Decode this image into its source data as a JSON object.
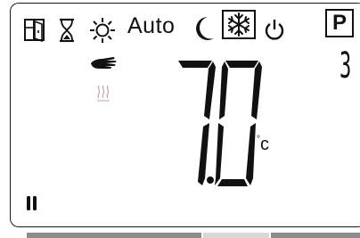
{
  "display": {
    "mode_label": "Auto",
    "program_label": "P",
    "program_number": "3",
    "temperature": "7.0",
    "temperature_unit": "°C",
    "unit_symbol": "c"
  },
  "icons": [
    "window-open-icon",
    "hourglass-icon",
    "sun-icon",
    "moon-icon",
    "snowflake-icon",
    "power-icon",
    "hand-icon",
    "heating-icon",
    "pause-icon"
  ],
  "status_bar": {
    "segments": 3,
    "active_color": "#8c8c8c",
    "inactive_color": "#d8d8d8"
  }
}
